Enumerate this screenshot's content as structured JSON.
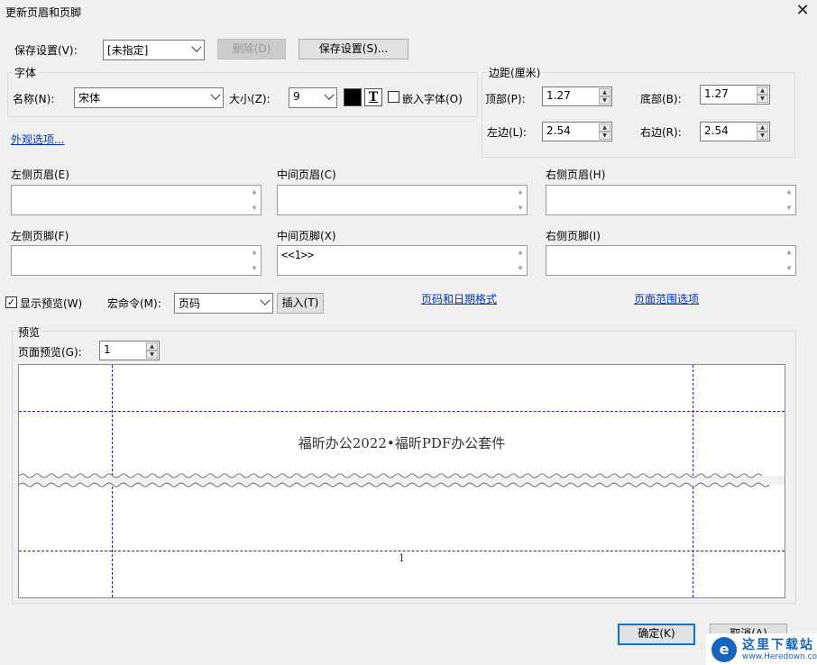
{
  "window": {
    "title": "更新页眉和页脚",
    "close_glyph": "✕"
  },
  "saved_settings": {
    "label": "保存设置(V):",
    "value": "[未指定]",
    "delete_label": "删除(D)",
    "save_label": "保存设置(S)..."
  },
  "font": {
    "group_label": "字体",
    "name_label": "名称(N):",
    "name_value": "宋体",
    "size_label": "大小(Z):",
    "size_value": "9",
    "color": "#000000",
    "underline_glyph": "T",
    "embed_label": "嵌入字体(O)",
    "embed_checked": false
  },
  "appearance_link": "外观选项...",
  "margins": {
    "group_label": "边距(厘米)",
    "top_label": "顶部(P):",
    "top_value": "1.27",
    "bottom_label": "底部(B):",
    "bottom_value": "1.27",
    "left_label": "左边(L):",
    "left_value": "2.54",
    "right_label": "右边(R):",
    "right_value": "2.54"
  },
  "headers": {
    "left_label": "左侧页眉(E)",
    "left_value": "",
    "center_label": "中间页眉(C)",
    "center_value": "",
    "right_label": "右侧页眉(H)",
    "right_value": ""
  },
  "footers": {
    "left_label": "左侧页脚(F)",
    "left_value": "",
    "center_label": "中间页脚(X)",
    "center_value": "<<1>>",
    "right_label": "右侧页脚(I)",
    "right_value": ""
  },
  "options": {
    "show_preview_label": "显示预览(W)",
    "show_preview_checked": true,
    "macro_label": "宏命令(M):",
    "macro_value": "页码",
    "insert_label": "插入(T)",
    "page_date_link": "页码和日期格式",
    "page_range_link": "页面范围选项"
  },
  "preview": {
    "group_label": "预览",
    "page_label": "页面预览(G):",
    "page_value": "1",
    "header_text": "福昕办公2022•福昕PDF办公套件",
    "footer_text": "1"
  },
  "buttons": {
    "ok_label": "确定(K)",
    "cancel_label": "取消(A)"
  },
  "watermark": {
    "title": "这里下载站",
    "url": "www.Heredown.com"
  },
  "icons": {
    "spin_up": "▲",
    "spin_down": "▼",
    "check": "✓"
  }
}
